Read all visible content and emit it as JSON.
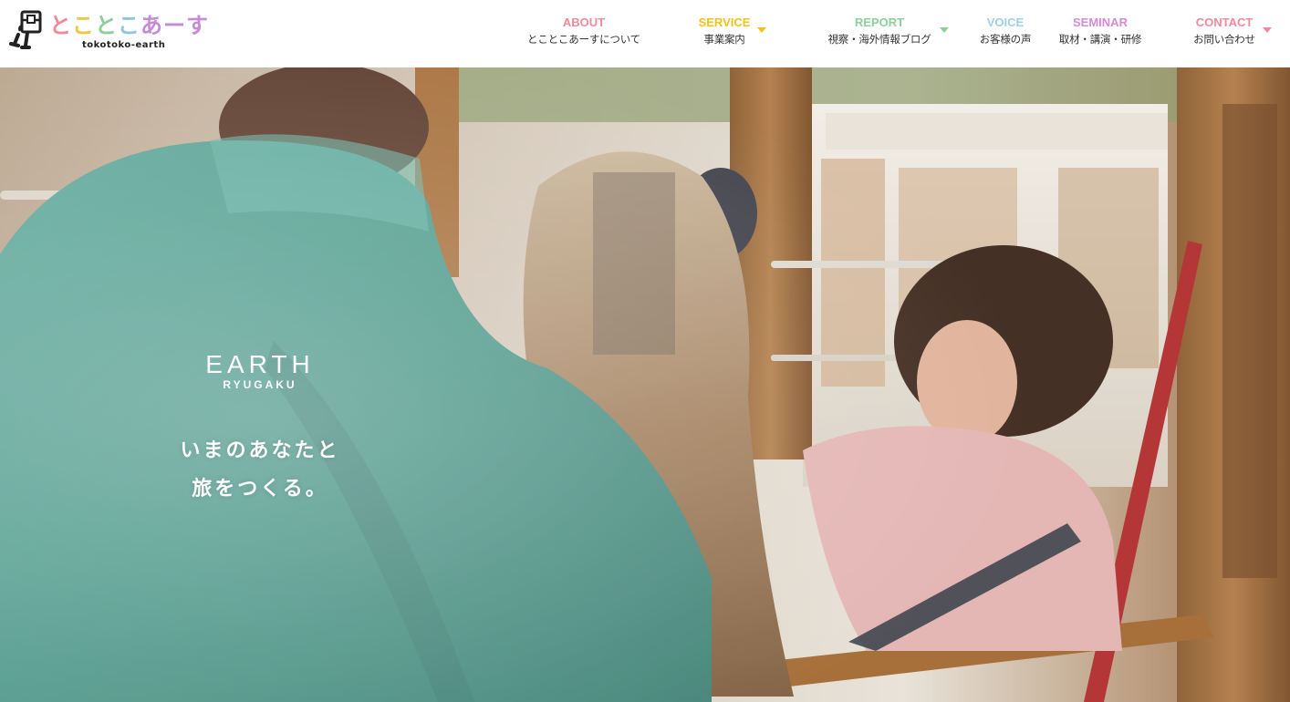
{
  "brand": {
    "logo_text": [
      "と",
      "こ",
      "と",
      "こ",
      "あ",
      "ー",
      "す"
    ],
    "logo_colors": [
      "#ee8a9b",
      "#f2c544",
      "#8ccf9a",
      "#8fc3ea",
      "#c58ad8",
      "#c58ad8",
      "#c58ad8"
    ],
    "logo_subtitle": "tokotoko-earth",
    "logo_icon": "backpack-walker-icon"
  },
  "nav": [
    {
      "en": "ABOUT",
      "ja": "とことこあーすについて",
      "color": "#ee8a9b",
      "dropdown": false
    },
    {
      "en": "SERVICE",
      "ja": "事業案内",
      "color": "#f2c21a",
      "dropdown": true
    },
    {
      "en": "REPORT",
      "ja": "視察・海外情報ブログ",
      "color": "#8ccf9a",
      "dropdown": true
    },
    {
      "en": "VOICE",
      "ja": "お客様の声",
      "color": "#9dd0ee",
      "dropdown": false
    },
    {
      "en": "SEMINAR",
      "ja": "取材・講演・研修",
      "color": "#d48ad6",
      "dropdown": false
    },
    {
      "en": "CONTACT",
      "ja": "お問い合わせ",
      "color": "#ee8a9b",
      "dropdown": true
    }
  ],
  "hero": {
    "brand_main": "EARTH",
    "brand_sub": "RYUGAKU",
    "tagline_line1": "いまのあなたと",
    "tagline_line2": "旅をつくる。"
  }
}
